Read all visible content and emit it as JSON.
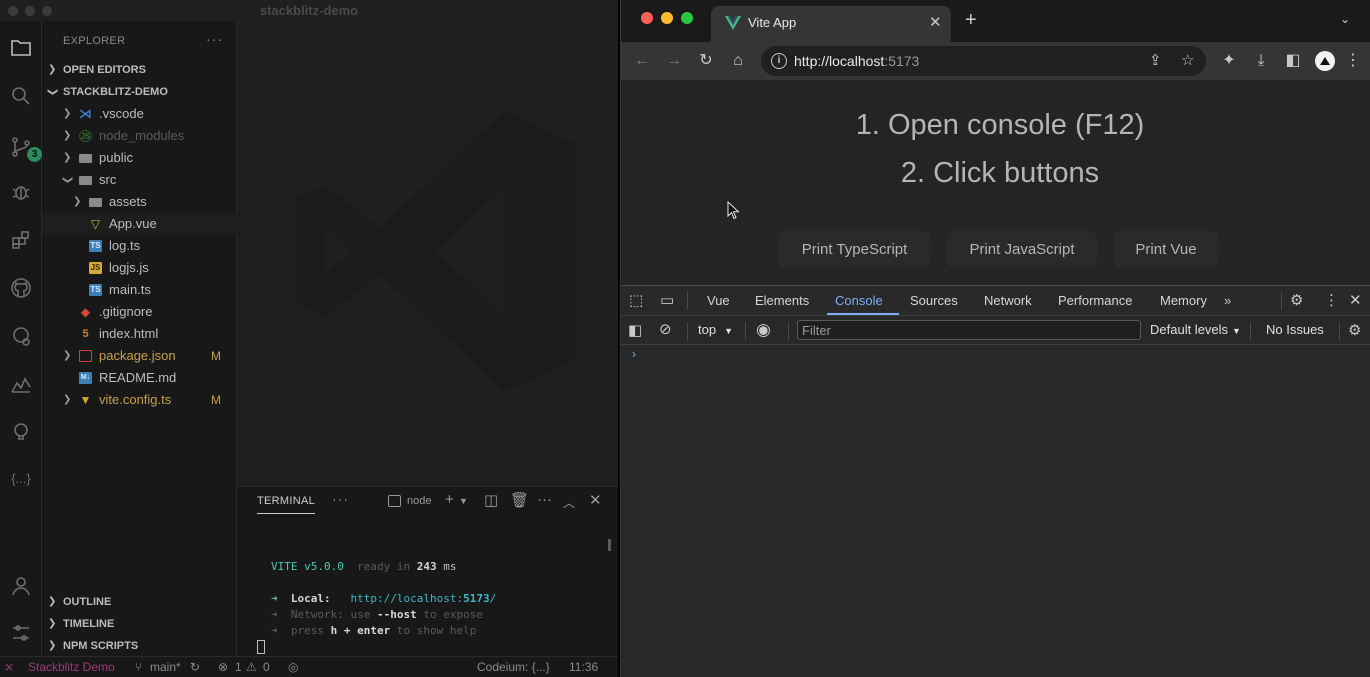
{
  "ide": {
    "title": "stackblitz-demo",
    "explorer_label": "EXPLORER",
    "explorer_more": "···",
    "scm_badge": "3",
    "sections": {
      "open_editors": "OPEN EDITORS",
      "project": "STACKBLITZ-DEMO",
      "outline": "OUTLINE",
      "timeline": "TIMELINE",
      "npm_scripts": "NPM SCRIPTS"
    },
    "tree": [
      {
        "name": ".vscode",
        "icon": "vscode-folder-icon",
        "modified": ""
      },
      {
        "name": "node_modules",
        "icon": "node-folder-icon",
        "modified": ""
      },
      {
        "name": "public",
        "icon": "folder-icon",
        "modified": ""
      },
      {
        "name": "src",
        "icon": "folder-open-icon",
        "modified": ""
      },
      {
        "name": "assets",
        "icon": "folder-icon",
        "modified": ""
      },
      {
        "name": "App.vue",
        "icon": "vue-file-icon",
        "modified": ""
      },
      {
        "name": "log.ts",
        "icon": "ts-file-icon",
        "modified": ""
      },
      {
        "name": "logjs.js",
        "icon": "js-file-icon",
        "modified": ""
      },
      {
        "name": "main.ts",
        "icon": "ts-file-icon",
        "modified": ""
      },
      {
        "name": ".gitignore",
        "icon": "git-file-icon",
        "modified": ""
      },
      {
        "name": "index.html",
        "icon": "html-file-icon",
        "modified": ""
      },
      {
        "name": "package.json",
        "icon": "npm-file-icon",
        "modified": "M"
      },
      {
        "name": "README.md",
        "icon": "markdown-file-icon",
        "modified": ""
      },
      {
        "name": "vite.config.ts",
        "icon": "vite-file-icon",
        "modified": "M"
      }
    ],
    "terminal": {
      "tab": "TERMINAL",
      "more": "···",
      "shell": "node",
      "vite_name": "VITE",
      "vite_version": "v5.0.0",
      "ready_text": "ready in",
      "ready_ms": "243",
      "ready_unit": "ms",
      "local_label": "Local:",
      "local_url_prefix": "http://localhost:",
      "local_port": "5173",
      "local_url_suffix": "/",
      "network_label": "Network:",
      "network_text_a": "use",
      "network_flag": "--host",
      "network_text_b": "to expose",
      "help_text_a": "press",
      "help_key_h": "h",
      "help_plus": "+",
      "help_key_enter": "enter",
      "help_text_b": "to show help",
      "arrow": "➜"
    },
    "status": {
      "remote": "Stackblitz Demo",
      "branch": "main*",
      "errors": "1",
      "warnings": "0",
      "codeium": "Codeium: {...}",
      "time": "11:36"
    }
  },
  "browser": {
    "tab_title": "Vite App",
    "url_host": "http://localhost",
    "url_port": ":5173",
    "page": {
      "instruction_1": "1. Open console (F12)",
      "instruction_2": "2. Click buttons",
      "buttons": [
        "Print TypeScript",
        "Print JavaScript",
        "Print Vue"
      ]
    },
    "devtools": {
      "tabs": [
        "Vue",
        "Elements",
        "Console",
        "Sources",
        "Network",
        "Performance",
        "Memory"
      ],
      "active_tab": "Console",
      "context": "top",
      "filter_placeholder": "Filter",
      "levels": "Default levels",
      "issues": "No Issues",
      "prompt": "›"
    }
  }
}
